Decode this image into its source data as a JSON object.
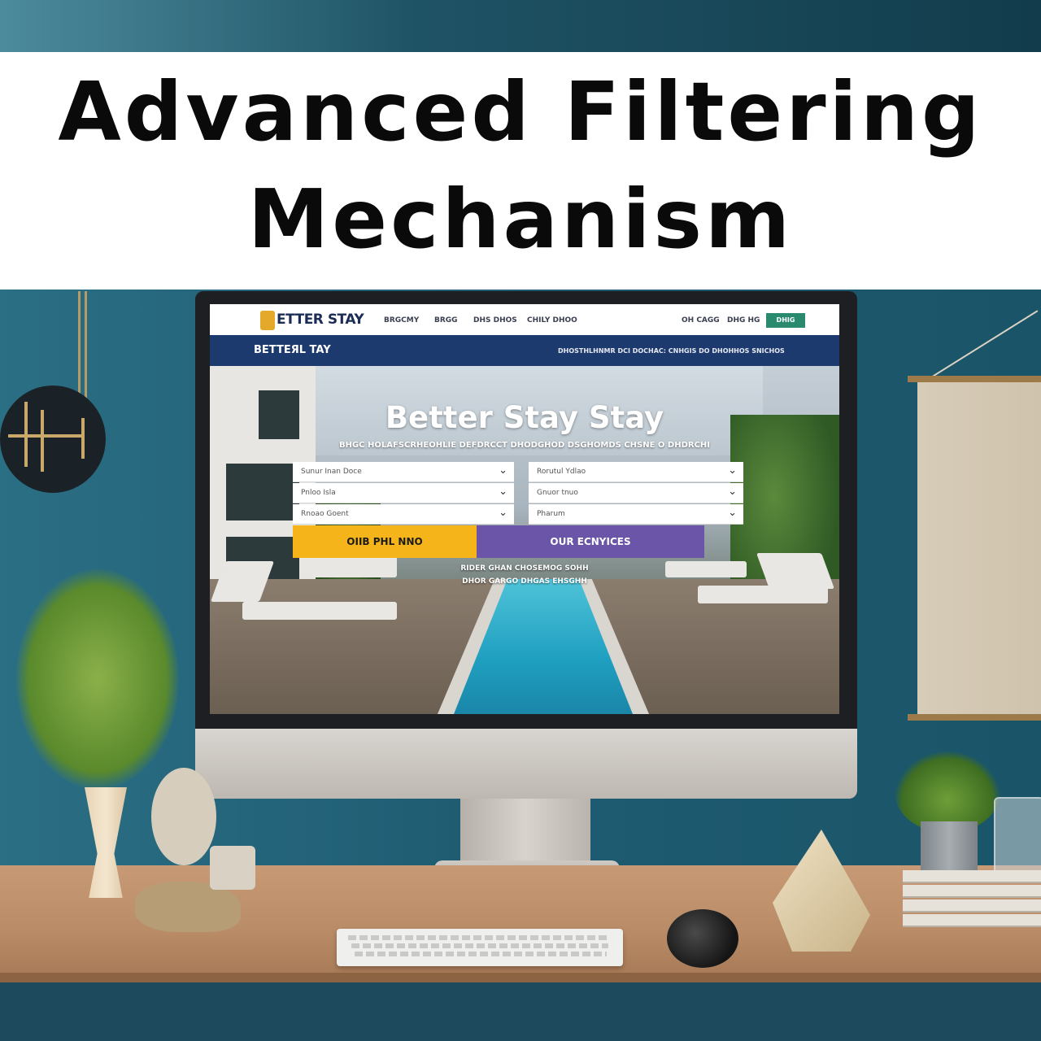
{
  "banner": {
    "line1": "Advanced Filtering",
    "line2": "Mechanism"
  },
  "website": {
    "logo_text": "ETTER STAY",
    "nav_links": [
      "BRGCMY",
      "BRGG",
      "DHS DHOS",
      "CHILY DHOO"
    ],
    "nav_right": [
      "OH CAGG",
      "DHG HG"
    ],
    "nav_button": "DHIG",
    "subnav_brand": "BETTEЯL TAY",
    "subnav_info": "DHOSTHLHNMR DCI DOCHAC: CNHGIS DO DHOHHOS SNICHOS",
    "hero_title": "Better Stay Stay",
    "hero_sub": "BHGC HOLAFSCRHEOHLIE DEFDRCCT DHODGHOD DSGHOMDS CHSNE O DHDRCHI",
    "filters_left": [
      "Sunur Inan Doce",
      "Pnloo Isla",
      "Rnoao Goent"
    ],
    "filters_right": [
      "Rorutul Ydlao",
      "Gnuor tnuo",
      "Pharum"
    ],
    "btn_yellow": "OIIB PHL NNO",
    "btn_purple": "OUR ECNYICES",
    "note1": "RIDER GHAN CHOSEMOG SOHH",
    "note2": "DHOR GARGO DHGAS EHSGHH"
  },
  "colors": {
    "nav_bg": "#ffffff",
    "subnav_bg": "#1c3a6e",
    "btn_yellow": "#f5b51a",
    "btn_purple": "#6a55a8",
    "nav_button": "#2a8a6e",
    "logo_accent": "#e4a92b"
  }
}
